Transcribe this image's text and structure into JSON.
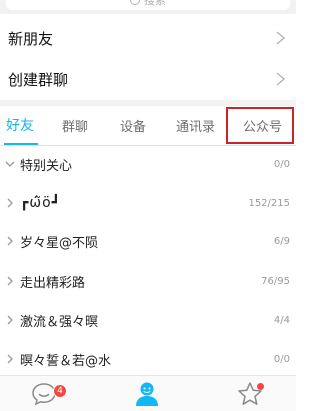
{
  "search": {
    "placeholder": "搜索"
  },
  "menu": [
    {
      "label": "新朋友"
    },
    {
      "label": "创建群聊"
    }
  ],
  "tabs": [
    {
      "label": "好友",
      "active": true
    },
    {
      "label": "群聊",
      "active": false
    },
    {
      "label": "设备",
      "active": false
    },
    {
      "label": "通讯录",
      "active": false
    },
    {
      "label": "公众号",
      "active": false
    }
  ],
  "groups": [
    {
      "name": "特别关心",
      "count": "0/0",
      "expanded": true
    },
    {
      "name": "┏ώ̃ӧ┛",
      "count": "152/215",
      "expanded": false
    },
    {
      "name": "岁々星@不陨",
      "count": "6/9",
      "expanded": false
    },
    {
      "name": "走出精彩路",
      "count": "76/95",
      "expanded": false
    },
    {
      "name": "激流＆强々暝",
      "count": "4/4",
      "expanded": false
    },
    {
      "name": "暝々誓＆若@水",
      "count": "0/0",
      "expanded": false
    }
  ],
  "bottom_nav": {
    "messages_badge": "4",
    "items": [
      {
        "icon": "chat-bubble-icon",
        "active": false
      },
      {
        "icon": "contacts-person-icon",
        "active": true
      },
      {
        "icon": "star-icon",
        "active": false
      }
    ]
  },
  "colors": {
    "accent": "#12b7f5",
    "highlight_box": "#c9252b",
    "badge": "#f2483f"
  }
}
